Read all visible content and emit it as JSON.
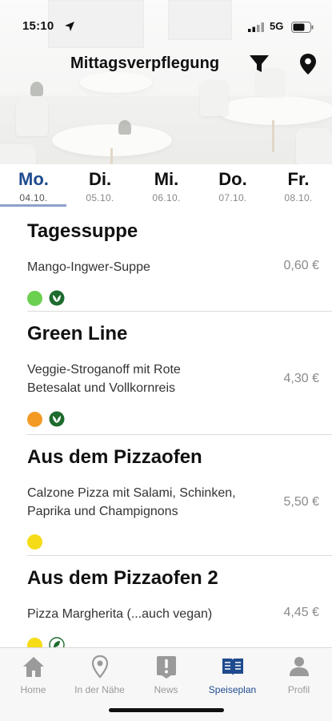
{
  "status_bar": {
    "time": "15:10",
    "network": "5G"
  },
  "header": {
    "title": "Mittagsverpflegung"
  },
  "days": [
    {
      "name": "Mo.",
      "date": "04.10.",
      "active": true
    },
    {
      "name": "Di.",
      "date": "05.10."
    },
    {
      "name": "Mi.",
      "date": "06.10."
    },
    {
      "name": "Do.",
      "date": "07.10."
    },
    {
      "name": "Fr.",
      "date": "08.10."
    }
  ],
  "menu": [
    {
      "heading": "Tagessuppe",
      "dish": "Mango-Ingwer-Suppe",
      "price": "0,60 €",
      "dot_color": "#6bcf4f",
      "vegan": true
    },
    {
      "heading": "Green Line",
      "dish": "Veggie-Stroganoff mit Rote Betesalat und Vollkornreis",
      "price": "4,30 €",
      "dot_color": "#f39a25",
      "vegan": true
    },
    {
      "heading": "Aus dem Pizzaofen",
      "dish": "Calzone Pizza mit Salami, Schinken, Paprika und Champignons",
      "price": "5,50 €",
      "dot_color": "#f5dc16",
      "vegan": false
    },
    {
      "heading": "Aus dem Pizzaofen 2",
      "dish": "Pizza Margherita (...auch vegan)",
      "price": "4,45 €",
      "dot_color": "#f5dc16",
      "vegan": true
    }
  ],
  "tabbar": {
    "items": [
      {
        "label": "Home",
        "icon": "house-icon"
      },
      {
        "label": "In der Nähe",
        "icon": "location-pin-icon"
      },
      {
        "label": "News",
        "icon": "exclamation-icon"
      },
      {
        "label": "Speiseplan",
        "icon": "open-book-icon",
        "active": true
      },
      {
        "label": "Profil",
        "icon": "person-icon"
      }
    ]
  },
  "colors": {
    "accent": "#1f4b8e",
    "vegan_green": "#1e6b2e",
    "inactive": "#9a9a9a"
  }
}
